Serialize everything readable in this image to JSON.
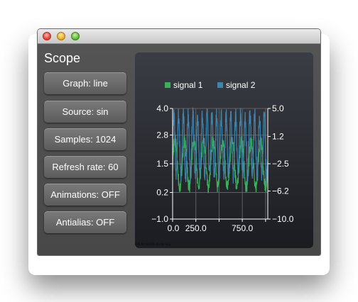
{
  "window": {
    "title": ""
  },
  "sidebar": {
    "title": "Scope",
    "buttons": [
      {
        "label": "Graph: line"
      },
      {
        "label": "Source: sin"
      },
      {
        "label": "Samples: 1024"
      },
      {
        "label": "Refresh rate: 60"
      },
      {
        "label": "Animations: OFF"
      },
      {
        "label": "Antialias: OFF"
      }
    ]
  },
  "colors": {
    "signal1": "#3bb05a",
    "signal2": "#3f84ad",
    "axis": "#ffffff",
    "grid": "#606060"
  },
  "chart_data": {
    "type": "line",
    "legend_position": "top",
    "grid": true,
    "series": [
      {
        "name": "signal 1",
        "axis": "left",
        "center": 1.5,
        "amplitude": 1.05,
        "jitter": 0.6,
        "cycles": 10
      },
      {
        "name": "signal 2",
        "axis": "right",
        "center": 0.0,
        "amplitude": 1.0,
        "jitter": 0.6,
        "cycles": 20
      }
    ],
    "x": {
      "min": 0,
      "max": 1024,
      "ticks": [
        0.0,
        250.0,
        500.0,
        750.0,
        1000.0
      ],
      "labels": [
        "0.0",
        "250.0",
        "750.0"
      ]
    },
    "y_left": {
      "min": -1.0,
      "max": 4.0,
      "ticks": [
        4.0,
        2.8,
        1.5,
        0.2,
        -1.0
      ],
      "labels": [
        "4.0",
        "2.8",
        "1.5",
        "0.2",
        "−1.0"
      ]
    },
    "y_right": {
      "min": -10.0,
      "max": 5.0,
      "ticks": [
        5.0,
        1.2,
        -2.5,
        -6.2,
        -10.0
      ],
      "labels": [
        "5.0",
        "1.2",
        "−2.5",
        "−6.2",
        "−10.0"
      ]
    }
  },
  "status_text": "FPS 60.00 FPS 60.00 Avg"
}
